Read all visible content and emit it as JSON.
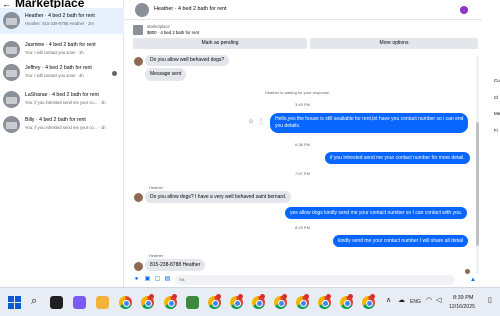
{
  "left_panel": {
    "title": "Marketplace",
    "conversations": [
      {
        "name": "Heather · 4 bed 2 bath for rent",
        "preview": "Heather: 815-238-8788 Heather · 2m",
        "active": true
      },
      {
        "name": "Jasmine · 4 bed 2 bath for rent",
        "preview": "You: I will contact you soon · 1h",
        "active": false
      },
      {
        "name": "Jeffrey · 4 bed 2 bath for rent",
        "preview": "You: I will contact you soon · 4h",
        "active": false
      },
      {
        "name": "LaSharae · 4 bed 2 bath for rent",
        "preview": "You: if you intrested send me your co... · 1h",
        "active": false
      },
      {
        "name": "Billy · 4 bed 2 bath for rent",
        "preview": "You: if you intrested send me your co... · 1h",
        "active": false
      }
    ]
  },
  "chat": {
    "header_title": "Heather · 4 bed 2 bath for rent",
    "listing": {
      "name": "Marketplace",
      "price": "$800 · 4 bed 2 bath for rent",
      "pending_label": "Mark as pending",
      "more_label": "More options"
    },
    "messages": {
      "m1": "Do you allow well behaved dogs?",
      "m2": "Message sent",
      "notice": "Heather is waiting for your response.",
      "ts1": "3:49 PM",
      "m3_line1": "Hello,yes the house is still available for rent,let have you contact number so i can end",
      "m3_line2": "you details.",
      "ts2": "6:38 PM",
      "m4": "if you intrested send me your contact number for more detail.",
      "ts3": "7:57 PM",
      "sender1": "Heather",
      "m5": "Do you allow dogs? I have a very well behaved saint bernard.",
      "m6": "yes allow dogs kindly send me your contact number so I can contact with you.",
      "ts4": "8:29 PM",
      "m7": "kindly send me your contact number I will share all detail",
      "sender2": "Heather",
      "m8": "815-238-8788 Heather"
    },
    "composer_placeholder": "Aa"
  },
  "right_strip": {
    "items": [
      "Cu",
      "Cl",
      "Me",
      "Fi"
    ]
  },
  "taskbar": {
    "tray_lang": "ENG",
    "time": "8:39 PM",
    "date": "12/16/2025"
  },
  "colors": {
    "accent": "#0866ff",
    "bubble_in": "#e4e6eb",
    "active_row": "#e7f0fd"
  }
}
